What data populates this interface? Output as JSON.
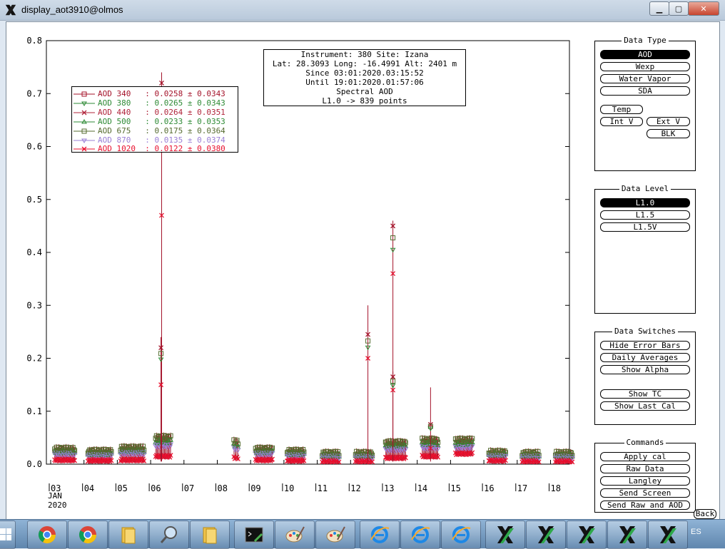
{
  "window": {
    "title": "display_aot3910@olmos",
    "minimize_label": "▁",
    "maximize_label": "▢",
    "close_label": "✕"
  },
  "info": {
    "line1": "Instrument: 380 Site: Izana",
    "line2": "Lat: 28.3093 Long: -16.4991 Alt: 2401 m",
    "line3": "Since 03:01:2020.03:15:52",
    "line4": "Until 19:01:2020.01:57:06",
    "line5": "Spectral AOD",
    "line6": "L1.0 -> 839 points"
  },
  "legend": [
    {
      "name": "AOD 340",
      "text": "AOD 340   : 0.0258 ± 0.0343",
      "color": "#a4132a",
      "symbol": "square"
    },
    {
      "name": "AOD 380",
      "text": "AOD 380   : 0.0265 ± 0.0343",
      "color": "#2e8a35",
      "symbol": "triangle-down"
    },
    {
      "name": "AOD 440",
      "text": "AOD 440   : 0.0264 ± 0.0351",
      "color": "#b0243a",
      "symbol": "x"
    },
    {
      "name": "AOD 500",
      "text": "AOD 500   : 0.0233 ± 0.0353",
      "color": "#2e8a35",
      "symbol": "triangle-up"
    },
    {
      "name": "AOD 675",
      "text": "AOD 675   : 0.0175 ± 0.0364",
      "color": "#556b2f",
      "symbol": "square"
    },
    {
      "name": "AOD 870",
      "text": "AOD 870   : 0.0135 ± 0.0374",
      "color": "#9a7fd6",
      "symbol": "triangle-down"
    },
    {
      "name": "AOD 1020",
      "text": "AOD 1020  : 0.0122 ± 0.0380",
      "color": "#e8102e",
      "symbol": "x"
    }
  ],
  "chart_data": {
    "type": "scatter",
    "title": "Spectral AOD",
    "ylim": [
      0,
      0.8
    ],
    "xlim": [
      3,
      19
    ],
    "y_ticks": [
      "0.0",
      "0.1",
      "0.2",
      "0.3",
      "0.4",
      "0.5",
      "0.6",
      "0.7",
      "0.8"
    ],
    "x_ticks": [
      "03",
      "04",
      "05",
      "06",
      "07",
      "08",
      "09",
      "10",
      "11",
      "12",
      "13",
      "14",
      "15",
      "16",
      "17",
      "18"
    ],
    "x_tick_values": [
      3,
      4,
      5,
      6,
      7,
      8,
      9,
      10,
      11,
      12,
      13,
      14,
      15,
      16,
      17,
      18
    ],
    "x_month_label": "JAN",
    "x_year_label": "2020",
    "grid": false,
    "legend_position": "top-left",
    "daily_clusters": [
      {
        "day": 3,
        "start": 3.12,
        "end": 3.72,
        "aod340": 0.028,
        "aod1020": 0.008
      },
      {
        "day": 4,
        "start": 4.12,
        "end": 4.82,
        "aod340": 0.024,
        "aod1020": 0.007
      },
      {
        "day": 5,
        "start": 5.1,
        "end": 5.8,
        "aod340": 0.03,
        "aod1020": 0.008
      },
      {
        "day": 6,
        "start": 6.15,
        "end": 6.6,
        "aod340": 0.05,
        "aod1020": 0.015
      },
      {
        "day": 8,
        "start": 8.5,
        "end": 8.62,
        "aod340": 0.042,
        "aod1020": 0.012
      },
      {
        "day": 9,
        "start": 9.15,
        "end": 9.65,
        "aod340": 0.028,
        "aod1020": 0.008
      },
      {
        "day": 10,
        "start": 10.1,
        "end": 10.6,
        "aod340": 0.024,
        "aod1020": 0.007
      },
      {
        "day": 11,
        "start": 11.15,
        "end": 11.65,
        "aod340": 0.02,
        "aod1020": 0.006
      },
      {
        "day": 12,
        "start": 12.15,
        "end": 12.65,
        "aod340": 0.02,
        "aod1020": 0.006
      },
      {
        "day": 13,
        "start": 13.05,
        "end": 13.65,
        "aod340": 0.04,
        "aod1020": 0.012
      },
      {
        "day": 14,
        "start": 14.15,
        "end": 14.62,
        "aod340": 0.045,
        "aod1020": 0.015
      },
      {
        "day": 15,
        "start": 15.15,
        "end": 15.65,
        "aod340": 0.045,
        "aod1020": 0.02
      },
      {
        "day": 16,
        "start": 16.15,
        "end": 16.65,
        "aod340": 0.022,
        "aod1020": 0.007
      },
      {
        "day": 17,
        "start": 17.15,
        "end": 17.65,
        "aod340": 0.02,
        "aod1020": 0.006
      },
      {
        "day": 18,
        "start": 18.15,
        "end": 18.65,
        "aod340": 0.02,
        "aod1020": 0.006
      }
    ],
    "spikes": [
      {
        "x": 6.33,
        "aod340": 0.72,
        "aod1020": 0.47,
        "err": 0.02
      },
      {
        "x": 6.31,
        "aod340": 0.22,
        "aod1020": 0.15,
        "err": 0.02
      },
      {
        "x": 12.52,
        "aod340": 0.245,
        "aod1020": 0.2,
        "err": 0.055
      },
      {
        "x": 13.27,
        "aod340": 0.45,
        "aod1020": 0.36,
        "err": 0.01
      },
      {
        "x": 13.27,
        "aod340": 0.165,
        "aod1020": 0.14,
        "err": 0.01
      },
      {
        "x": 14.4,
        "aod340": 0.075,
        "aod1020": 0.03,
        "err": 0.07
      }
    ]
  },
  "panels": {
    "data_type": {
      "title": "Data Type",
      "buttons": {
        "aod": "AOD",
        "wexp": "Wexp",
        "water_vapor": "Water Vapor",
        "sda": "SDA",
        "temp": "Temp",
        "int_v": "Int V",
        "ext_v": "Ext V",
        "blk": "BLK"
      }
    },
    "data_level": {
      "title": "Data Level",
      "buttons": {
        "l10": "L1.0",
        "l15": "L1.5",
        "l15v": "L1.5V"
      }
    },
    "data_switches": {
      "title": "Data Switches",
      "buttons": {
        "hide_error_bars": "Hide Error Bars",
        "daily_averages": "Daily Averages",
        "show_alpha": "Show Alpha",
        "show_tc": "Show TC",
        "show_last_cal": "Show Last Cal"
      }
    },
    "commands": {
      "title": "Commands",
      "buttons": {
        "apply_cal": "Apply cal",
        "raw_data": "Raw Data",
        "langley": "Langley",
        "send_screen": "Send Screen",
        "send_raw_aod": "Send Raw and AOD"
      }
    }
  },
  "back_label": "Back",
  "taskbar": {
    "language": "ES",
    "items": [
      "chrome-icon",
      "chrome-icon",
      "folder-icon",
      "search-icon",
      "folder-icon",
      "terminal-icon",
      "paint-icon",
      "paint-icon",
      "ie-icon",
      "ie-icon",
      "ie-icon",
      "x-icon",
      "x-icon",
      "x-icon",
      "x-icon",
      "x-icon"
    ]
  },
  "colors": {
    "series340": "#a4132a",
    "series1020": "#e8102e",
    "green": "#2e8a35",
    "olive": "#556b2f",
    "purple": "#9a7fd6"
  }
}
